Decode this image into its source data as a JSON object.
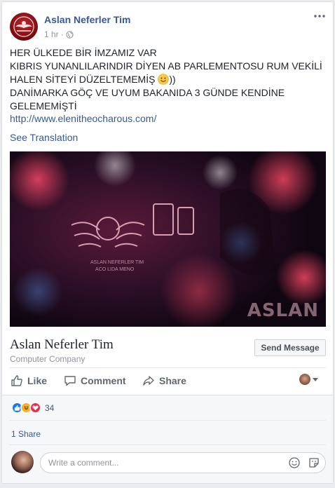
{
  "post": {
    "page_name": "Aslan Neferler Tim",
    "time": "1 hr",
    "separator": "·",
    "audience_icon": "globe-icon",
    "text_lines": [
      "HER ÜLKEDE BİR İMZAMIZ VAR",
      "KIBRIS YUNANLILARINDIR DİYEN AB PARLEMENTOSU RUM VEKİLİ",
      "HALEN SİTEYİ DÜZELTEMEMİŞ",
      "))",
      "DANİMARKA GÖÇ VE UYUM BAKANIDA 3 GÜNDE KENDİNE",
      "GELEMEMİŞTİ"
    ],
    "link": "http://www.elenitheocharous.com/",
    "see_translation": "See Translation"
  },
  "video": {
    "watermark": "ASLAN"
  },
  "page_card": {
    "title": "Aslan Neferler Tim",
    "category": "Computer Company",
    "send_message": "Send Message"
  },
  "actions": {
    "like": "Like",
    "comment": "Comment",
    "share": "Share"
  },
  "stats": {
    "reaction_count": "34",
    "shares": "1 Share"
  },
  "comment": {
    "placeholder": "Write a comment..."
  },
  "colors": {
    "link_blue": "#365899",
    "like_blue": "#1877f2",
    "haha_yellow": "#f7b125",
    "love_red": "#f0284a"
  }
}
